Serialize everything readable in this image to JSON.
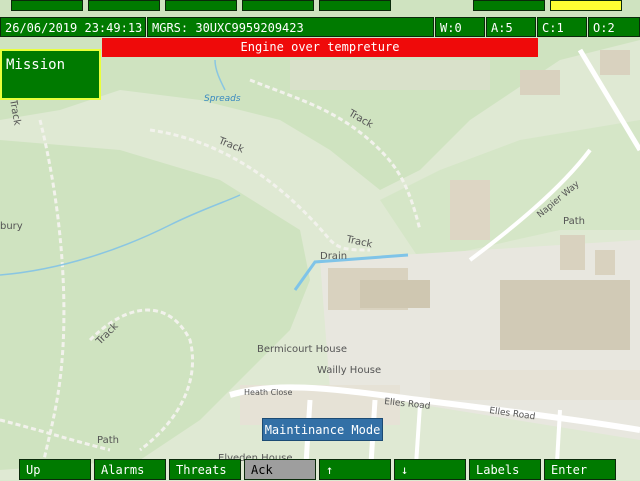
{
  "status": {
    "datetime": "26/06/2019 23:49:13",
    "mgrs": "MGRS: 30UXC9959209423",
    "w": "W:0",
    "a": "A:5",
    "c": "C:1",
    "o": "O:2"
  },
  "alarm": {
    "message": "Engine over tempreture"
  },
  "mission": {
    "label": "Mission"
  },
  "mode": {
    "label": "Maintinance Mode"
  },
  "softkeys": [
    "Up",
    "Alarms",
    "Threats",
    "Ack",
    "↑",
    "↓",
    "Labels",
    "Enter"
  ],
  "map_labels": {
    "spreads": "Spreads",
    "track1": "Track",
    "track2": "Track",
    "track3": "Track",
    "track4": "Track",
    "track5": "Track",
    "drain": "Drain",
    "path1": "Path",
    "path2": "Path",
    "napier_way": "Napier Way",
    "bermicourt_house": "Bermicourt House",
    "wailly_house": "Wailly House",
    "heath_close": "Heath Close",
    "elles_road1": "Elles Road",
    "elles_road2": "Elles Road",
    "bury": "bury",
    "elveden_house": "Elveden House"
  },
  "colors": {
    "panel_green": "#007a00",
    "alarm_red": "#ef0a0a",
    "highlight_yellow": "#ffff33",
    "mission_border": "#e9ff3b",
    "mode_blue": "#3370a6",
    "ack_gray": "#9e9e9e"
  }
}
